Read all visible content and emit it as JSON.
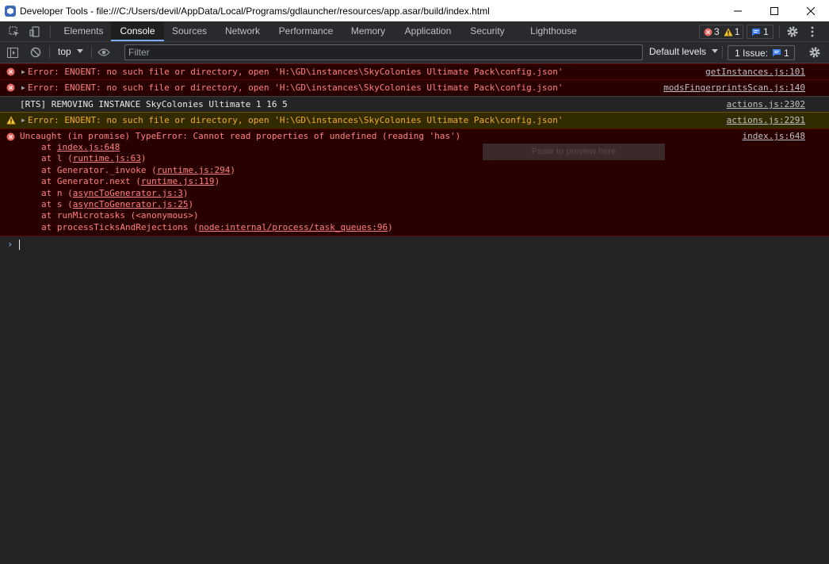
{
  "window": {
    "title": "Developer Tools - file:///C:/Users/devil/AppData/Local/Programs/gdlauncher/resources/app.asar/build/index.html",
    "icons": [
      "devtools-app-icon",
      "minimize-icon",
      "maximize-icon",
      "close-icon"
    ]
  },
  "tabs": [
    "Elements",
    "Console",
    "Sources",
    "Network",
    "Performance",
    "Memory",
    "Application",
    "Security",
    "Lighthouse"
  ],
  "active_tab": "Console",
  "counters": {
    "errors": "3",
    "warnings": "1",
    "messages": "1"
  },
  "console_toolbar": {
    "context": "top",
    "filter_placeholder": "Filter",
    "levels": "Default levels",
    "issues_label": "1 Issue:",
    "issues_count": "1"
  },
  "messages": [
    {
      "level": "error",
      "text": "Error: ENOENT: no such file or directory, open 'H:\\GD\\instances\\SkyColonies Ultimate Pack\\config.json'",
      "source": "getInstances.js:101"
    },
    {
      "level": "error",
      "text": "Error: ENOENT: no such file or directory, open 'H:\\GD\\instances\\SkyColonies Ultimate Pack\\config.json'",
      "source": "modsFingerprintsScan.js:140"
    },
    {
      "level": "info",
      "text": "[RTS] REMOVING INSTANCE SkyColonies Ultimate 1 16 5",
      "source": "actions.js:2302"
    },
    {
      "level": "warning",
      "text": "Error: ENOENT: no such file or directory, open 'H:\\GD\\instances\\SkyColonies Ultimate Pack\\config.json'",
      "source": "actions.js:2291"
    }
  ],
  "uncaught": {
    "text": "Uncaught (in promise) TypeError: Cannot read properties of undefined (reading 'has')",
    "source": "index.js:648",
    "stack": [
      {
        "pre": "at ",
        "link": "index.js:648",
        "post": ""
      },
      {
        "pre": "at l (",
        "link": "runtime.js:63",
        "post": ")"
      },
      {
        "pre": "at Generator._invoke (",
        "link": "runtime.js:294",
        "post": ")"
      },
      {
        "pre": "at Generator.next (",
        "link": "runtime.js:119",
        "post": ")"
      },
      {
        "pre": "at n (",
        "link": "asyncToGenerator.js:3",
        "post": ")"
      },
      {
        "pre": "at s (",
        "link": "asyncToGenerator.js:25",
        "post": ")"
      },
      {
        "pre": "at runMicrotasks (<anonymous>)",
        "link": "",
        "post": ""
      },
      {
        "pre": "at processTicksAndRejections (",
        "link": "node:internal/process/task_queues:96",
        "post": ")"
      }
    ]
  },
  "ghost_text": "Paste to preview here",
  "colors": {
    "error_bg": "#290000",
    "error_text": "#ff8080",
    "warning_bg": "#332b00",
    "warning_text": "#f2ab26",
    "accent": "#7cacf8"
  }
}
